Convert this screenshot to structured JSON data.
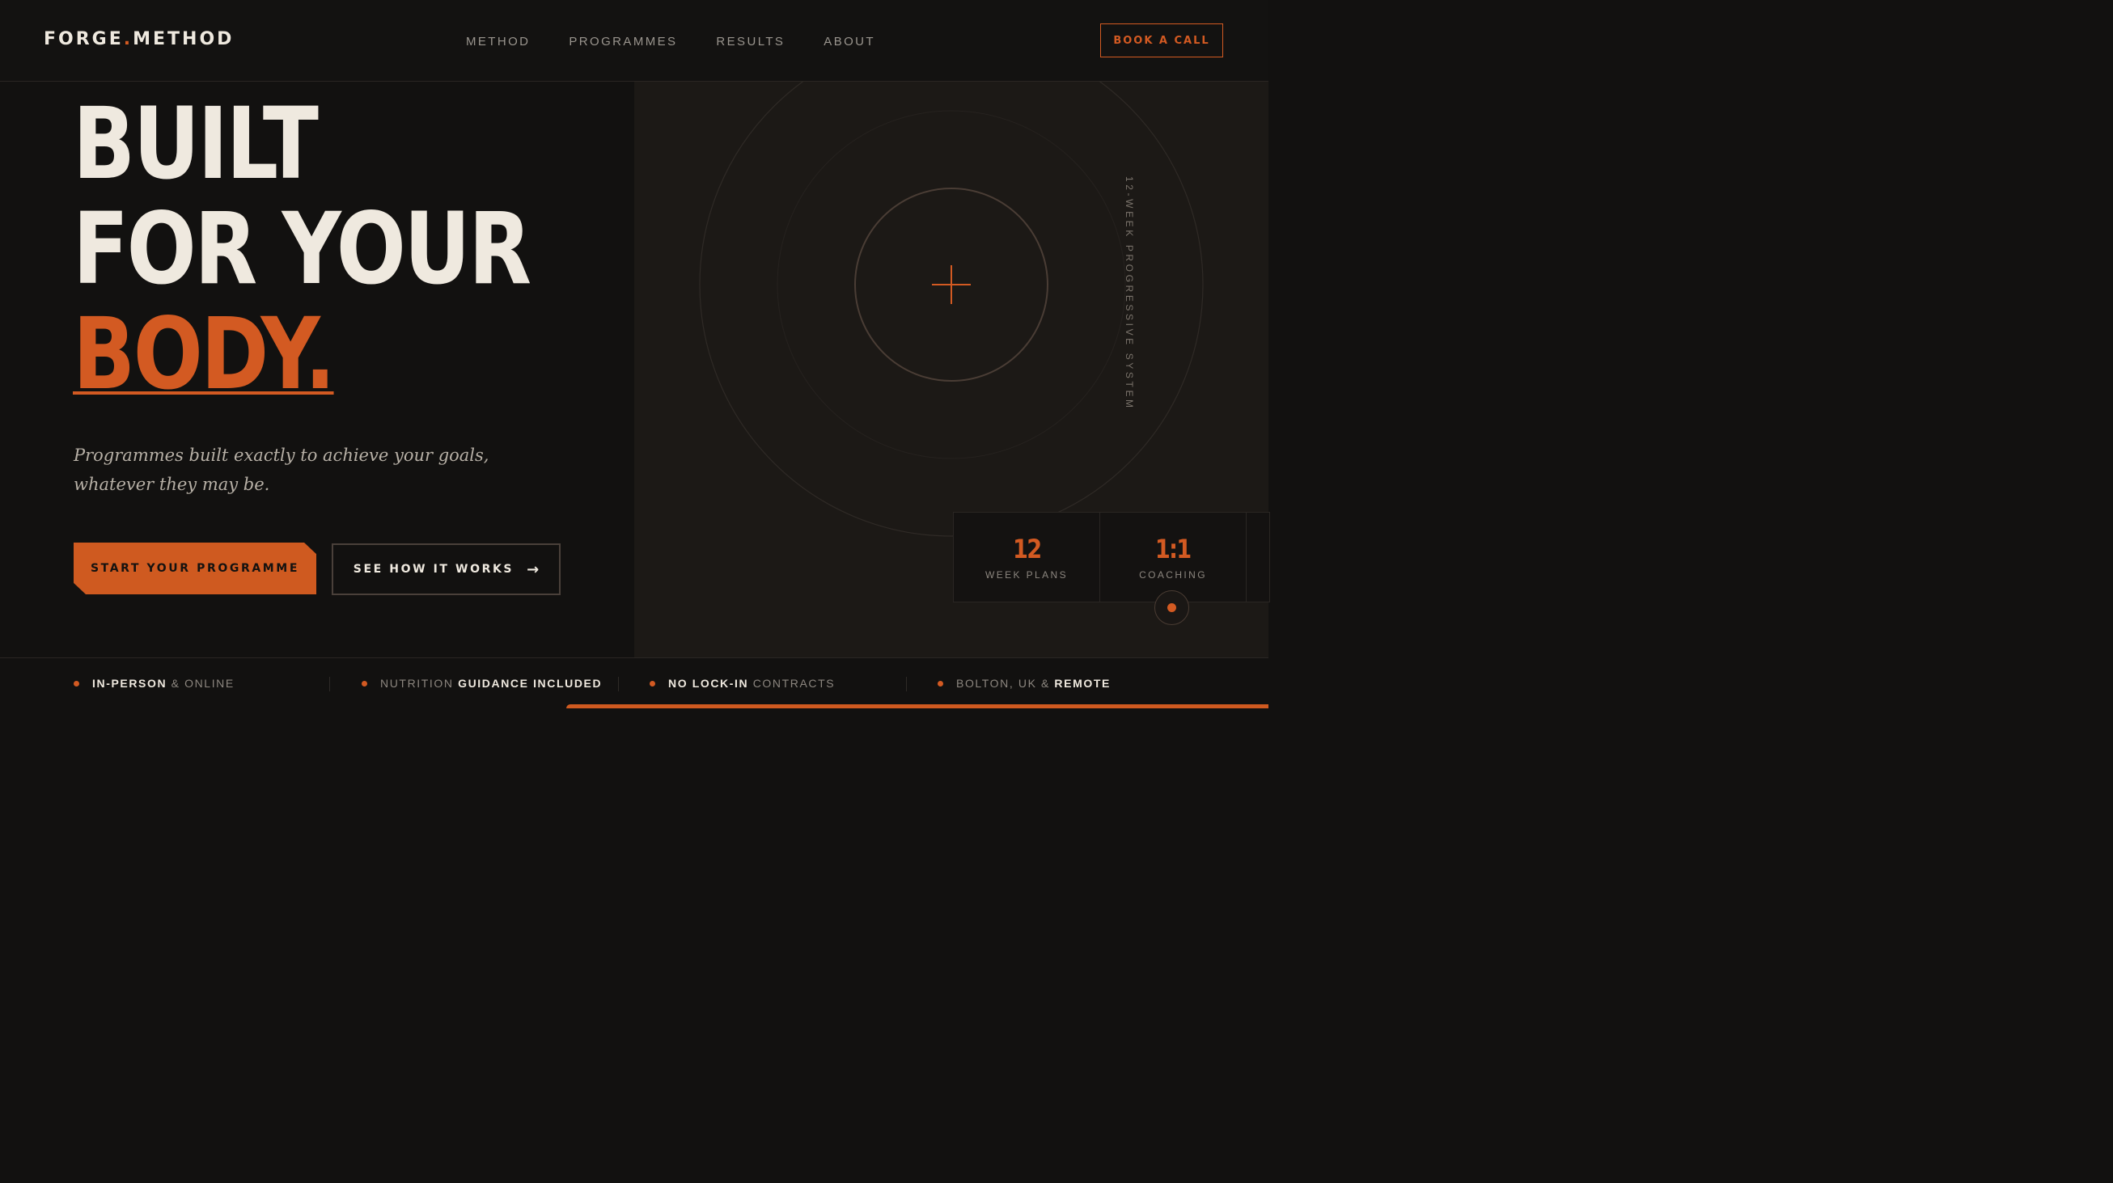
{
  "brand": {
    "name_left": "FORGE",
    "name_dot": ".",
    "name_right": "METHOD",
    "accent_color": "#d35a22"
  },
  "nav": {
    "links": [
      "METHOD",
      "PROGRAMMES",
      "RESULTS",
      "ABOUT"
    ],
    "cta_label": "BOOK A CALL"
  },
  "hero": {
    "line1": "BUILT",
    "line2": "FOR YOUR",
    "line3": "BODY.",
    "subtitle_line1": "Programmes built exactly to achieve your goals,",
    "subtitle_line2": "whatever they may be.",
    "primary_cta": "START YOUR PROGRAMME",
    "secondary_cta": "SEE HOW IT WORKS",
    "secondary_cta_icon": "arrow-right-icon"
  },
  "visual": {
    "vertical_label": "12-WEEK PROGRESSIVE SYSTEM",
    "center_icon": "plus-icon"
  },
  "stats": [
    {
      "value": "12",
      "label": "WEEK PLANS"
    },
    {
      "value": "1:1",
      "label": "COACHING"
    }
  ],
  "strip": [
    {
      "bold": "IN-PERSON",
      "rest": " & ONLINE",
      "bold_first": true
    },
    {
      "bold": "GUIDANCE INCLUDED",
      "rest": "NUTRITION ",
      "bold_first": false
    },
    {
      "bold": "NO LOCK-IN",
      "rest": " CONTRACTS",
      "bold_first": true
    },
    {
      "bold": "REMOTE",
      "rest": "BOLTON, UK & ",
      "bold_first": false
    }
  ]
}
